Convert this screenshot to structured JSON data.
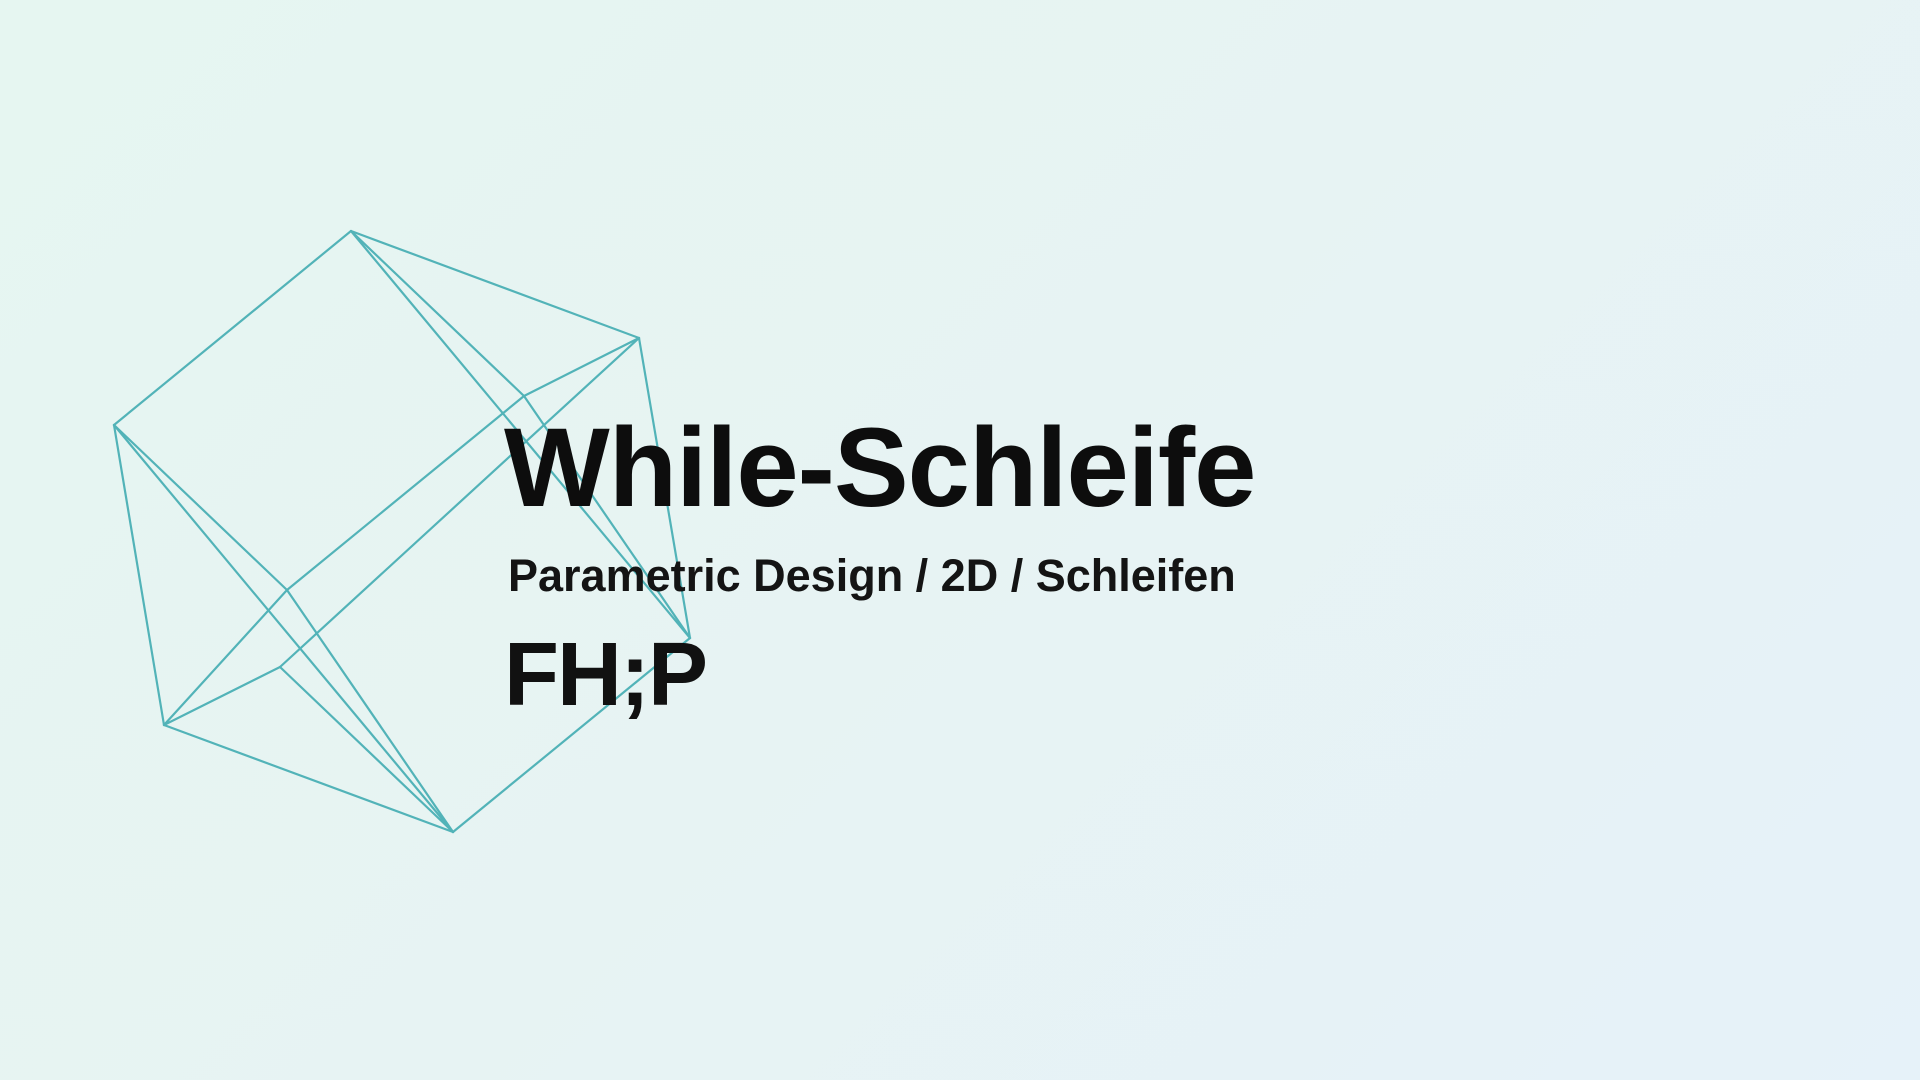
{
  "slide": {
    "title": "While-Schleife",
    "subtitle": "Parametric Design / 2D / Schleifen",
    "logo_text": "FH;P"
  },
  "colors": {
    "background_start": "#e6f6f1",
    "background_end": "#e6f2f9",
    "wireframe_stroke": "#52b3b8",
    "text": "#0d0d0d"
  },
  "graphic": {
    "name": "wireframe-polyhedron"
  }
}
